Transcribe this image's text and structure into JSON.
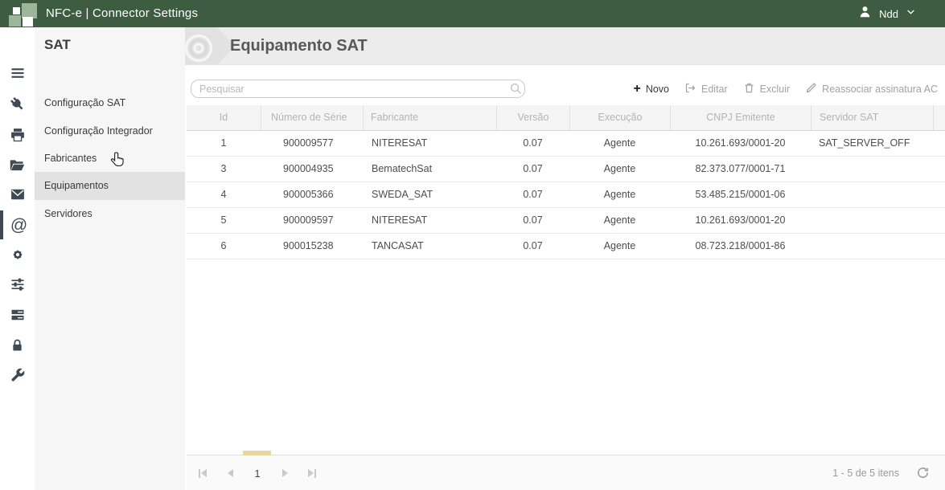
{
  "topbar": {
    "title": "NFC-e | Connector Settings",
    "user_name": "Ndd"
  },
  "rail": {
    "at_glyph": "@",
    "items": [
      {
        "icon": "menu-icon"
      },
      {
        "icon": "plug-icon"
      },
      {
        "icon": "printer-icon"
      },
      {
        "icon": "folder-icon"
      },
      {
        "icon": "mail-icon"
      },
      {
        "icon": "at-icon",
        "active": true
      },
      {
        "icon": "gear-icon"
      },
      {
        "icon": "sliders-icon"
      },
      {
        "icon": "server-icon"
      },
      {
        "icon": "lock-icon"
      },
      {
        "icon": "wrench-icon"
      }
    ]
  },
  "sidebar": {
    "heading": "SAT",
    "items": [
      {
        "label": "Configuração SAT"
      },
      {
        "label": "Configuração Integrador"
      },
      {
        "label": "Fabricantes"
      },
      {
        "label": "Equipamentos",
        "active": true
      },
      {
        "label": "Servidores"
      }
    ]
  },
  "page": {
    "title": "Equipamento SAT"
  },
  "search": {
    "placeholder": "Pesquisar"
  },
  "toolbar": {
    "buttons": [
      {
        "label": "Novo",
        "icon": "plus-icon",
        "enabled": true
      },
      {
        "label": "Editar",
        "icon": "edit-icon",
        "enabled": false
      },
      {
        "label": "Excluir",
        "icon": "trash-icon",
        "enabled": false
      },
      {
        "label": "Reassociar assinatura AC",
        "icon": "pencil-icon",
        "enabled": false
      }
    ]
  },
  "table": {
    "columns": [
      "Id",
      "Número de Série",
      "Fabricante",
      "Versão",
      "Execução",
      "CNPJ Emitente",
      "Servidor SAT"
    ],
    "rows": [
      {
        "id": "1",
        "serial": "900009577",
        "fabricante": "NITERESAT",
        "versao": "0.07",
        "execucao": "Agente",
        "cnpj": "10.261.693/0001-20",
        "servidor": "SAT_SERVER_OFF"
      },
      {
        "id": "3",
        "serial": "900004935",
        "fabricante": "BematechSat",
        "versao": "0.07",
        "execucao": "Agente",
        "cnpj": "82.373.077/0001-71",
        "servidor": ""
      },
      {
        "id": "4",
        "serial": "900005366",
        "fabricante": "SWEDA_SAT",
        "versao": "0.07",
        "execucao": "Agente",
        "cnpj": "53.485.215/0001-06",
        "servidor": ""
      },
      {
        "id": "5",
        "serial": "900009597",
        "fabricante": "NITERESAT",
        "versao": "0.07",
        "execucao": "Agente",
        "cnpj": "10.261.693/0001-20",
        "servidor": ""
      },
      {
        "id": "6",
        "serial": "900015238",
        "fabricante": "TANCASAT",
        "versao": "0.07",
        "execucao": "Agente",
        "cnpj": "08.723.218/0001-86",
        "servidor": ""
      }
    ]
  },
  "pager": {
    "current_page": "1",
    "info": "1 - 5 de 5 itens"
  },
  "colors": {
    "topbar_green": "#3d5c42",
    "logo_sage": "#9db59b",
    "icon_dark": "#3f4a54",
    "selected_page_highlight": "#e9d7a0",
    "header_band": "#ececec"
  }
}
